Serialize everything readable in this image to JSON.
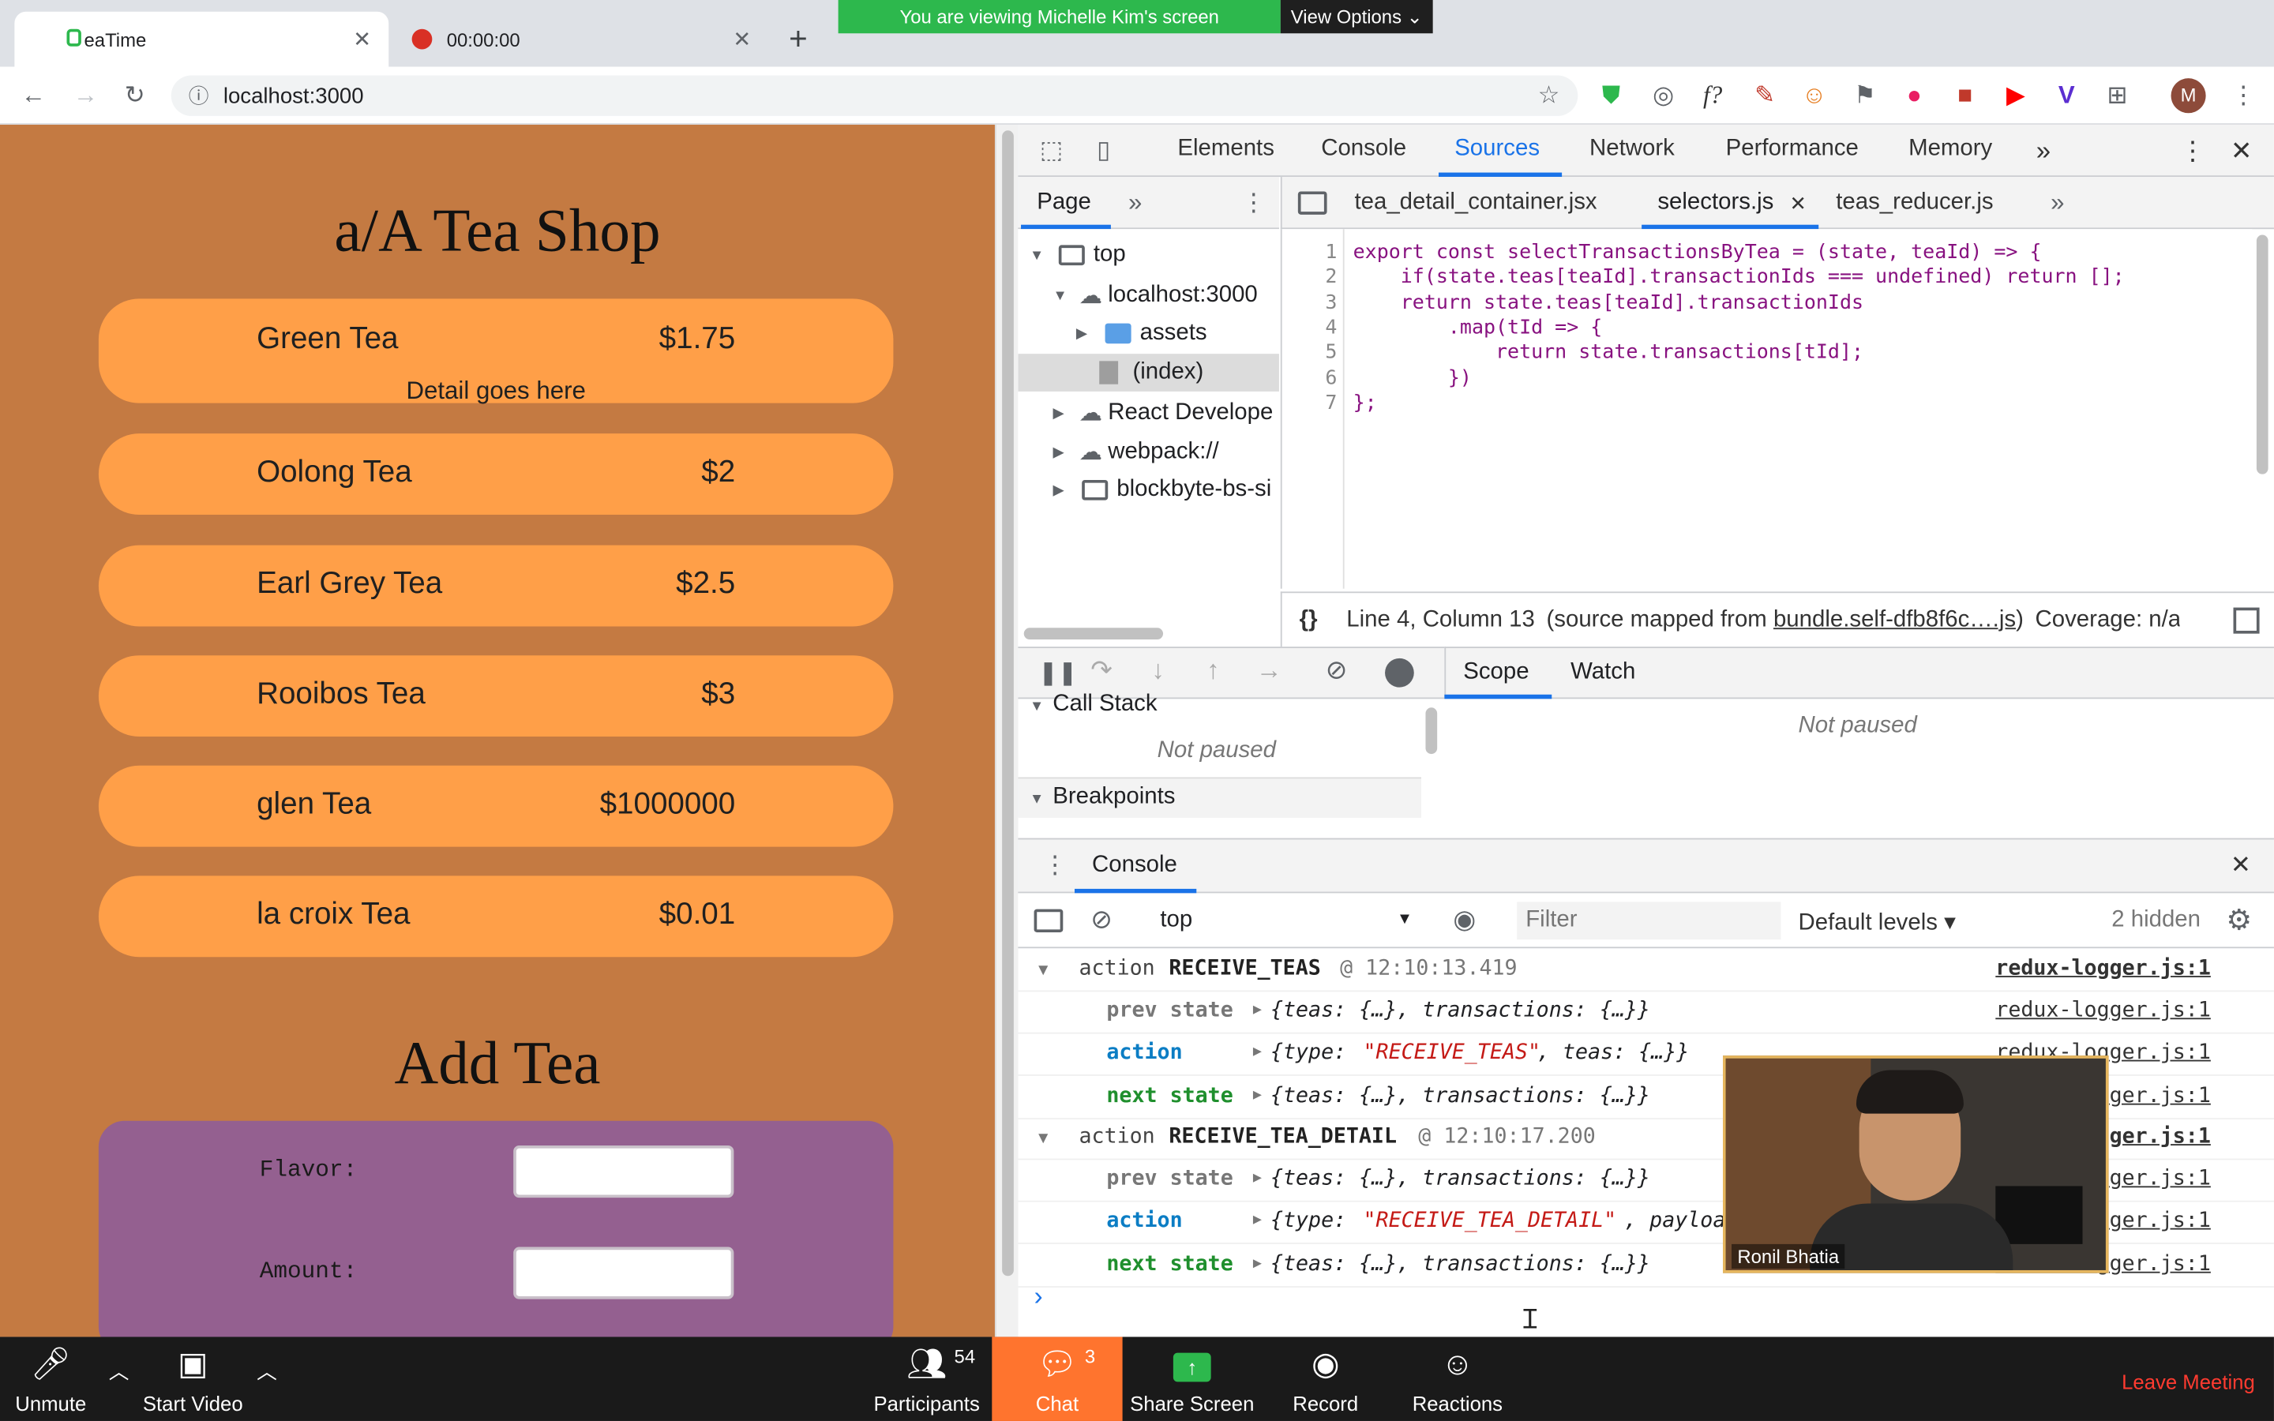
{
  "browser": {
    "tabs": [
      {
        "title": "eaTime",
        "close": "✕"
      },
      {
        "title": "00:00:00",
        "close": "✕"
      }
    ],
    "new_tab": "+",
    "url": "localhost:3000",
    "share_banner": "You are viewing Michelle Kim's screen",
    "view_options": "View Options ⌄",
    "profile_initial": "M"
  },
  "page": {
    "title": "a/A Tea Shop",
    "teas": [
      {
        "name": "Green Tea",
        "price": "$1.75",
        "detail": "Detail goes here"
      },
      {
        "name": "Oolong Tea",
        "price": "$2"
      },
      {
        "name": "Earl Grey Tea",
        "price": "$2.5"
      },
      {
        "name": "Rooibos Tea",
        "price": "$3"
      },
      {
        "name": "glen Tea",
        "price": "$1000000"
      },
      {
        "name": "la croix Tea",
        "price": "$0.01"
      }
    ],
    "add_title": "Add Tea",
    "form": {
      "flavor_label": "Flavor:",
      "amount_label": "Amount:"
    }
  },
  "devtools": {
    "tabs": [
      "Elements",
      "Console",
      "Sources",
      "Network",
      "Performance",
      "Memory"
    ],
    "active_tab": "Sources",
    "more": "»",
    "navigator": {
      "tab": "Page",
      "tree": [
        "top",
        "localhost:3000",
        "assets",
        "(index)",
        "React Develope",
        "webpack://",
        "blockbyte-bs-si"
      ]
    },
    "files": [
      {
        "name": "tea_detail_container.jsx"
      },
      {
        "name": "selectors.js",
        "close": "✕"
      },
      {
        "name": "teas_reducer.js"
      }
    ],
    "code_lines": [
      {
        "n": "1",
        "text": "export const selectTransactionsByTea = (state, teaId) => {"
      },
      {
        "n": "2",
        "text": "    if(state.teas[teaId].transactionIds === undefined) return [];"
      },
      {
        "n": "3",
        "text": "    return state.teas[teaId].transactionIds"
      },
      {
        "n": "4",
        "text": "        .map(tId => {"
      },
      {
        "n": "5",
        "text": "            return state.transactions[tId];"
      },
      {
        "n": "6",
        "text": "        })"
      },
      {
        "n": "7",
        "text": "};"
      }
    ],
    "status": {
      "braces": "{}",
      "position": "Line 4, Column 13",
      "mapped_prefix": "(source mapped from ",
      "mapped_link": "bundle.self-dfb8f6c….js",
      "mapped_suffix": ")",
      "coverage": "Coverage: n/a"
    },
    "debugger": {
      "call_stack": "Call Stack",
      "not_paused": "Not paused",
      "breakpoints": "Breakpoints",
      "scope": "Scope",
      "watch": "Watch",
      "scope_not_paused": "Not paused"
    },
    "console": {
      "title": "Console",
      "context": "top",
      "filter_placeholder": "Filter",
      "levels": "Default levels ▾",
      "hidden": "2 hidden",
      "source": "redux-logger.js:1",
      "groups": [
        {
          "label": "action",
          "name": "RECEIVE_TEAS",
          "time": "@ 12:10:13.419",
          "prev_label": "prev state",
          "prev_val": "{teas: {…}, transactions: {…}}",
          "action_label": "action",
          "action_pre": "{type: ",
          "action_type": "\"RECEIVE_TEAS\"",
          "action_post": ", teas: {…}}",
          "next_label": "next state",
          "next_val": "{teas: {…}, transactions: {…}}"
        },
        {
          "label": "action",
          "name": "RECEIVE_TEA_DETAIL",
          "time": "@ 12:10:17.200",
          "prev_label": "prev state",
          "prev_val": "{teas: {…}, transactions: {…}}",
          "action_label": "action",
          "action_pre": "{type: ",
          "action_type": "\"RECEIVE_TEA_DETAIL\"",
          "action_post": ", payloa",
          "next_label": "next state",
          "next_val": "{teas: {…}, transactions: {…}}"
        }
      ],
      "prompt": "›"
    }
  },
  "video": {
    "name": "Ronil Bhatia"
  },
  "zoom": {
    "unmute": "Unmute",
    "start_video": "Start Video",
    "participants": "Participants",
    "participants_count": "54",
    "chat": "Chat",
    "chat_count": "3",
    "share": "Share Screen",
    "record": "Record",
    "reactions": "Reactions",
    "leave": "Leave Meeting",
    "accent": "#ff742e"
  }
}
